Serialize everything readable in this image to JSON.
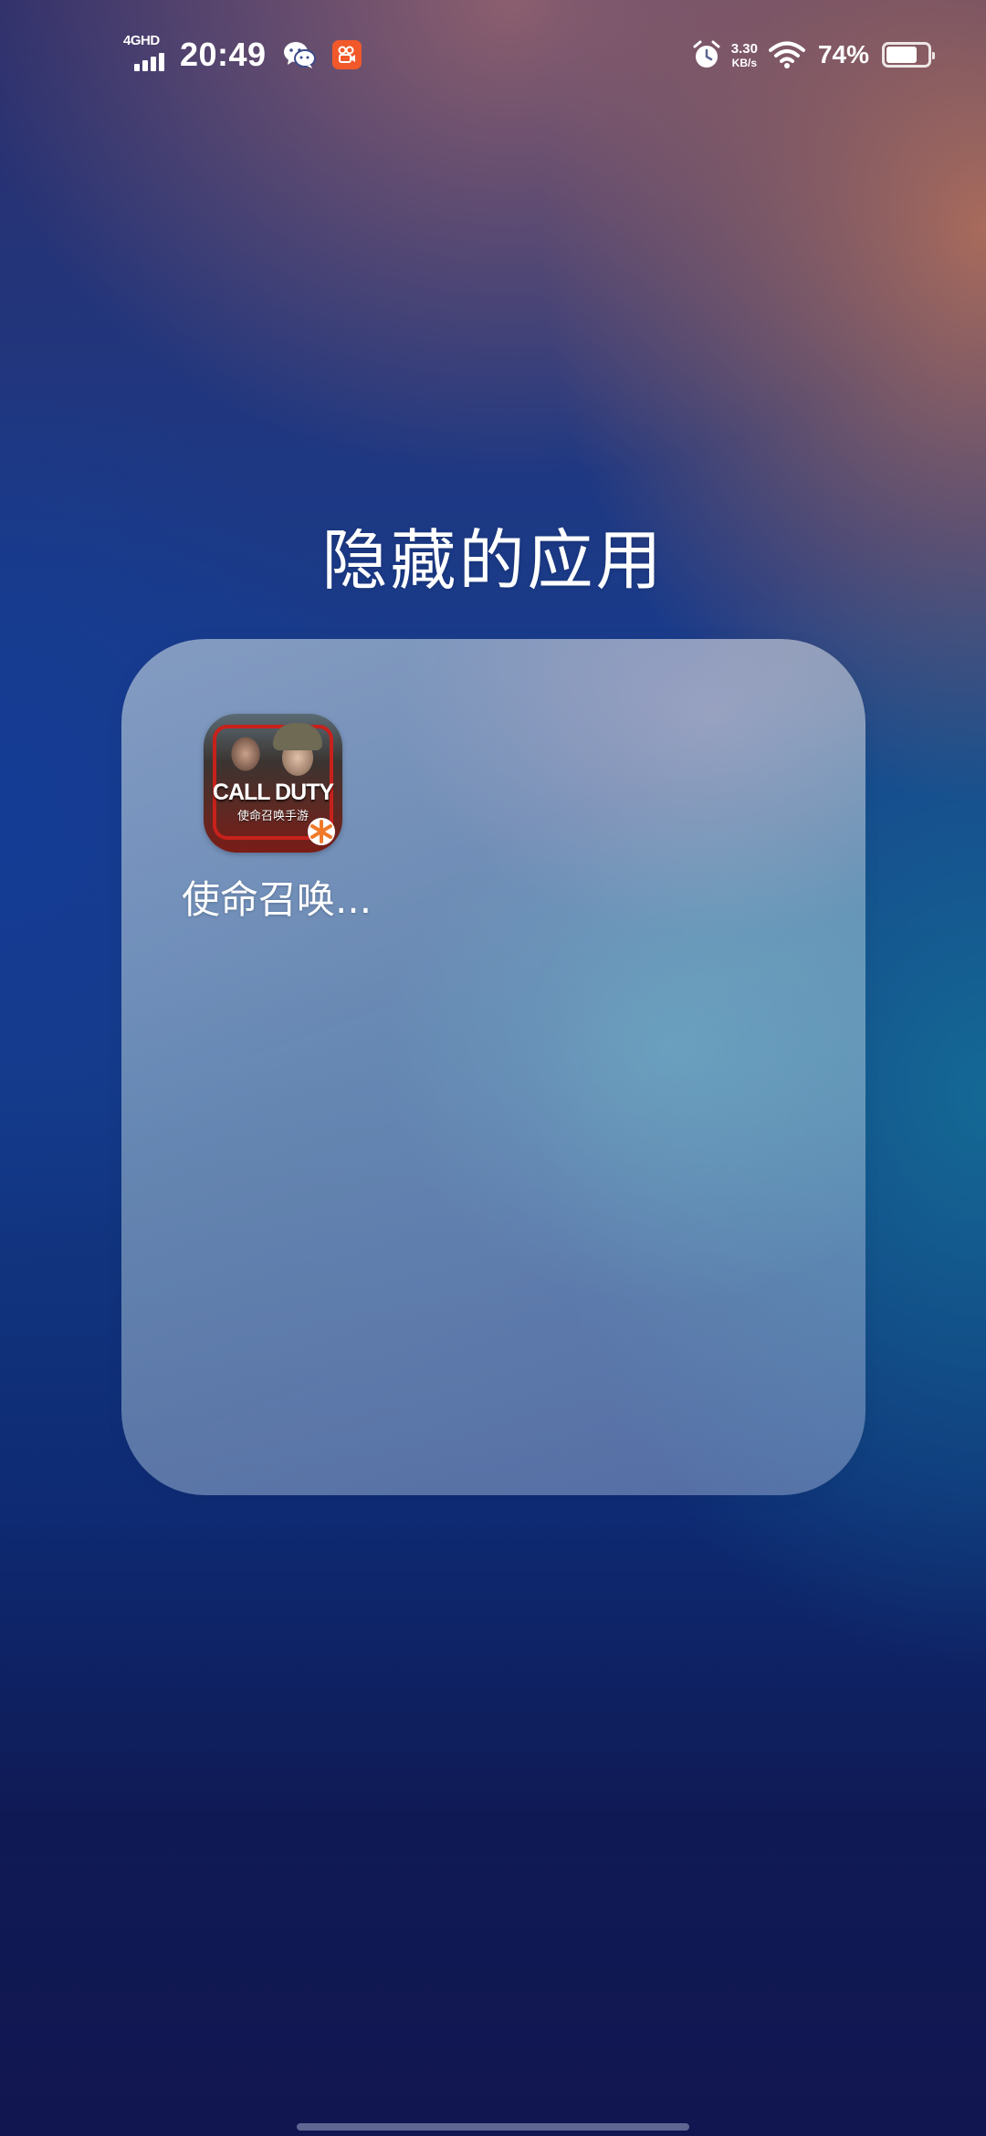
{
  "status_bar": {
    "network": "4GHD",
    "time": "20:49",
    "notification_icons": [
      "wechat-icon",
      "kuaishou-icon"
    ],
    "alarm_icon": "alarm-icon",
    "net_speed_value": "3.30",
    "net_speed_unit": "KB/s",
    "wifi_icon": "wifi-icon",
    "battery_percent": "74%",
    "battery_level": 0.74
  },
  "folder": {
    "title": "隐藏的应用",
    "apps": [
      {
        "label": "使命召唤...",
        "icon_text": "CALL DUTY",
        "icon_subtext": "使命召唤手游"
      }
    ]
  },
  "colors": {
    "kuaishou": "#f1592a",
    "cod_red": "#c7211b"
  }
}
